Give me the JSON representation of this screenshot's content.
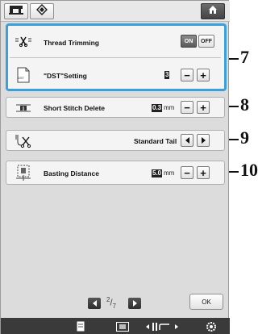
{
  "topbar": {
    "icons": [
      "sewing-machine-icon",
      "embroidery-frame-icon",
      "home-icon"
    ]
  },
  "rows": {
    "thread_trimming": {
      "label": "Thread Trimming",
      "on": "ON",
      "off": "OFF"
    },
    "dst_setting": {
      "label": "\"DST\"Setting",
      "icon_text": "DST",
      "value": "3",
      "minus": "−",
      "plus": "+"
    },
    "short_stitch": {
      "label": "Short Stitch Delete",
      "value": "0.3",
      "unit": "mm",
      "minus": "−",
      "plus": "+"
    },
    "tail": {
      "label": "Standard Tail"
    },
    "basting": {
      "label": "Basting Distance",
      "value": "5.0",
      "unit": "mm",
      "minus": "−",
      "plus": "+"
    }
  },
  "callouts": {
    "c7": "7",
    "c8": "8",
    "c9": "9",
    "c10": "10"
  },
  "pager": {
    "current": "2",
    "total": "7"
  },
  "ok_label": "OK",
  "colors": {
    "highlight": "#3aa0dc",
    "screen_bg": "#dcdcdc",
    "bottombar": "#3a3a3a"
  }
}
